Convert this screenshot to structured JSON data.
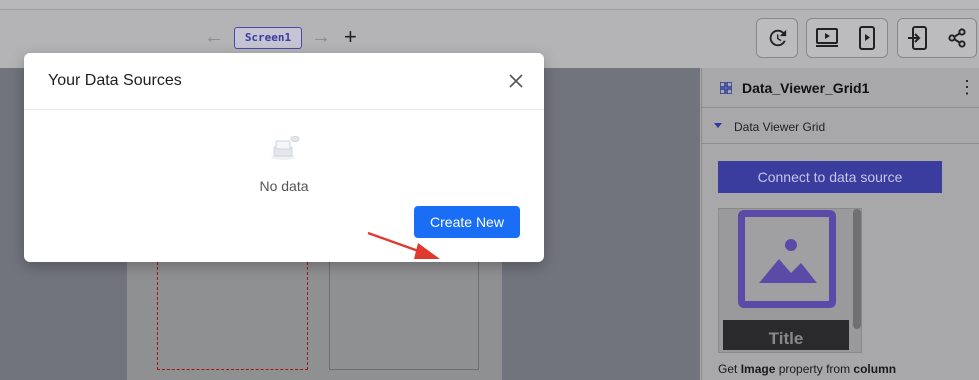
{
  "toolbar": {
    "screen_tab": "Screen1",
    "back_icon": "arrow-left-icon",
    "forward_icon": "arrow-right-icon",
    "add_icon": "plus-icon",
    "buttons": [
      "history-icon",
      "preview-icon",
      "device-preview-icon",
      "export-icon",
      "share-icon"
    ]
  },
  "panel": {
    "title": "Data_Viewer_Grid1",
    "section_label": "Data Viewer Grid",
    "connect_button": "Connect to data source",
    "card_title": "Title",
    "hint_prefix": "Get ",
    "hint_bold1": "Image",
    "hint_mid": " property from ",
    "hint_bold2": "column"
  },
  "modal": {
    "title": "Your Data Sources",
    "empty_text": "No data",
    "create_button": "Create New"
  },
  "colors": {
    "primary": "#1a6ef5",
    "annotation_arrow": "#e03a2f",
    "accent_purple": "#5b4aa8"
  }
}
